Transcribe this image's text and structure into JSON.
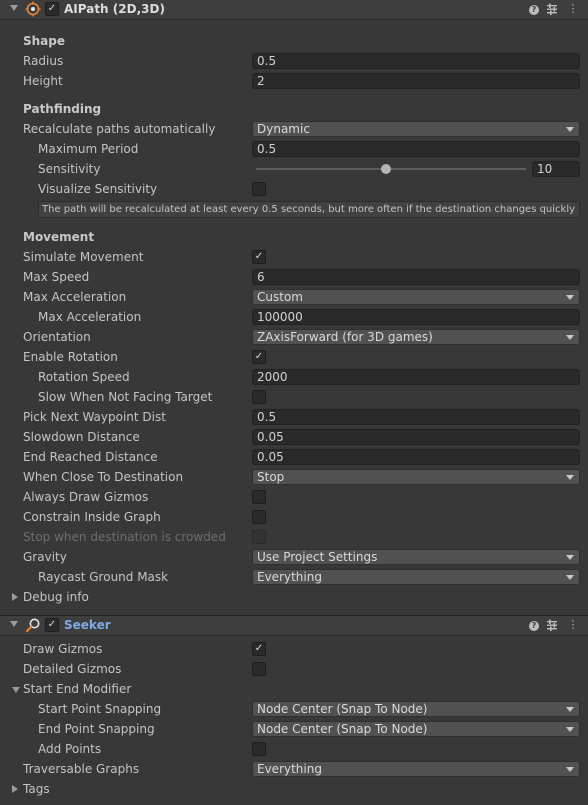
{
  "aipath": {
    "title": "AIPath (2D,3D)",
    "icon": "aipath-target-icon",
    "enabled": true,
    "shape": {
      "section": "Shape",
      "radius_label": "Radius",
      "radius_value": "0.5",
      "height_label": "Height",
      "height_value": "2"
    },
    "pathfinding": {
      "section": "Pathfinding",
      "recalc_label": "Recalculate paths automatically",
      "recalc_value": "Dynamic",
      "max_period_label": "Maximum Period",
      "max_period_value": "0.5",
      "sensitivity_label": "Sensitivity",
      "sensitivity_value": "10",
      "sensitivity_fraction": 0.48,
      "visualize_label": "Visualize Sensitivity",
      "visualize_checked": false,
      "help_text": "The path will be recalculated at least every 0.5 seconds, but more often if the destination changes quickly"
    },
    "movement": {
      "section": "Movement",
      "simulate_label": "Simulate Movement",
      "simulate_checked": true,
      "max_speed_label": "Max Speed",
      "max_speed_value": "6",
      "max_accel_label": "Max Acceleration",
      "max_accel_mode": "Custom",
      "max_accel_sub_label": "Max Acceleration",
      "max_accel_sub_value": "100000",
      "orientation_label": "Orientation",
      "orientation_value": "ZAxisForward (for 3D games)",
      "enable_rotation_label": "Enable Rotation",
      "enable_rotation_checked": true,
      "rotation_speed_label": "Rotation Speed",
      "rotation_speed_value": "2000",
      "slow_facing_label": "Slow When Not Facing Target",
      "slow_facing_checked": false,
      "pick_next_label": "Pick Next Waypoint Dist",
      "pick_next_value": "0.5",
      "slowdown_label": "Slowdown Distance",
      "slowdown_value": "0.05",
      "end_reached_label": "End Reached Distance",
      "end_reached_value": "0.05",
      "when_close_label": "When Close To Destination",
      "when_close_value": "Stop",
      "always_gizmos_label": "Always Draw Gizmos",
      "always_gizmos_checked": false,
      "constrain_label": "Constrain Inside Graph",
      "constrain_checked": false,
      "stop_crowded_label": "Stop when destination is crowded",
      "stop_crowded_checked": false,
      "gravity_label": "Gravity",
      "gravity_value": "Use Project Settings",
      "raycast_label": "Raycast Ground Mask",
      "raycast_value": "Everything"
    },
    "debug_label": "Debug info"
  },
  "seeker": {
    "title": "Seeker",
    "icon": "seeker-magnifier-icon",
    "enabled": true,
    "draw_gizmos_label": "Draw Gizmos",
    "draw_gizmos_checked": true,
    "detailed_gizmos_label": "Detailed Gizmos",
    "detailed_gizmos_checked": false,
    "start_end_label": "Start End Modifier",
    "start_snap_label": "Start Point Snapping",
    "start_snap_value": "Node Center (Snap To Node)",
    "end_snap_label": "End Point Snapping",
    "end_snap_value": "Node Center (Snap To Node)",
    "add_points_label": "Add Points",
    "add_points_checked": false,
    "traversable_label": "Traversable Graphs",
    "traversable_value": "Everything",
    "tags_label": "Tags"
  },
  "colors": {
    "background": "#383838",
    "header": "#3e3e3e",
    "seeker_title": "#7fa9e6",
    "aipath_icon": "#e8833a"
  }
}
